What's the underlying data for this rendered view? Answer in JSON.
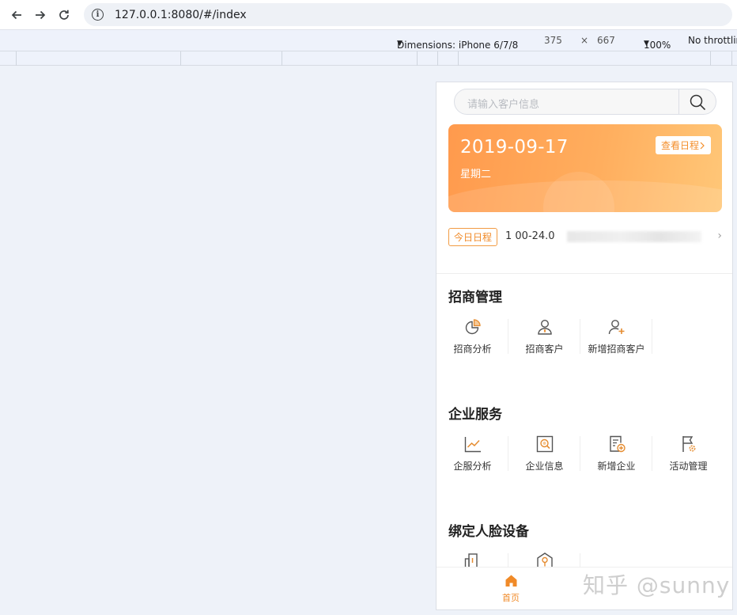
{
  "browser": {
    "url": "127.0.0.1:8080/#/index"
  },
  "devtools": {
    "dimensions_label": "Dimensions: iPhone 6/7/8",
    "width": "375",
    "times": "×",
    "height": "667",
    "zoom": "100%",
    "throttle": "No throttlin"
  },
  "app": {
    "search": {
      "placeholder": "请输入客户信息"
    },
    "banner": {
      "date": "2019-09-17",
      "weekday": "星期二",
      "button": "查看日程",
      "colors": [
        "#ff9a4d",
        "#ffc778"
      ]
    },
    "today": {
      "tag": "今日日程",
      "text": "1  00-24.0"
    },
    "sections": [
      {
        "title": "招商管理",
        "items": [
          {
            "label": "招商分析",
            "icon": "pie-chart-icon"
          },
          {
            "label": "招商客户",
            "icon": "user-icon"
          },
          {
            "label": "新增招商客户",
            "icon": "add-user-icon"
          }
        ]
      },
      {
        "title": "企业服务",
        "items": [
          {
            "label": "企服分析",
            "icon": "line-chart-icon"
          },
          {
            "label": "企业信息",
            "icon": "company-search-icon"
          },
          {
            "label": "新增企业",
            "icon": "add-document-icon"
          },
          {
            "label": "活动管理",
            "icon": "flag-icon"
          }
        ]
      },
      {
        "title": "绑定人脸设备",
        "items": [
          {
            "label": "",
            "icon": "building-icon"
          },
          {
            "label": "",
            "icon": "location-icon"
          }
        ]
      }
    ],
    "tabbar": {
      "home_label": "首页",
      "accent": "#f08a28"
    }
  },
  "watermark": "知乎 @sunny"
}
